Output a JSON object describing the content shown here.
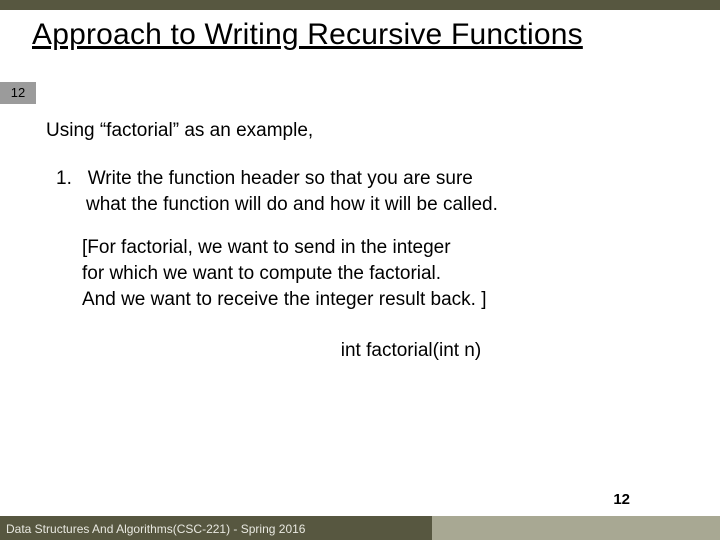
{
  "slide": {
    "title": "Approach to Writing Recursive Functions",
    "page_badge": "12",
    "intro": "Using “factorial” as an example,",
    "step": {
      "number": "1.",
      "line1": "Write the function header so that you are sure",
      "line2": "what the function will do and how it will be called."
    },
    "explain": {
      "l1": "[For factorial, we want to send in the integer",
      "l2": "for which we want to compute the factorial.",
      "l3": "And we want to receive the integer result back. ]"
    },
    "code": "int factorial(int n)",
    "page_number_bottom": "12",
    "footer": "Data Structures And Algorithms(CSC-221) - Spring 2016"
  }
}
